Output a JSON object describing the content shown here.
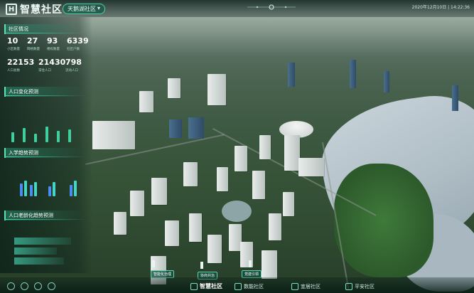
{
  "app": {
    "title": "智慧社区",
    "logo_mark": "H"
  },
  "header": {
    "community_selector": "天鹅湖社区",
    "datetime": "2020年12月10日 | 14:22:36"
  },
  "left_panel": {
    "community_status": {
      "title": "社区情况",
      "stats": [
        {
          "value": "10",
          "label": "小区数量"
        },
        {
          "value": "27",
          "label": "网格数量"
        },
        {
          "value": "93",
          "label": "楼栋数量"
        },
        {
          "value": "6339",
          "label": "社区户数"
        },
        {
          "value": "22153",
          "label": "人口总数"
        },
        {
          "value": "21430",
          "label": "常住人口"
        },
        {
          "value": "798",
          "label": "流动人口"
        }
      ]
    },
    "population_change": {
      "title": "人口变化预测"
    },
    "school_trend": {
      "title": "入学趋势预测"
    },
    "aging_trend": {
      "title": "人口老龄化趋势预测"
    }
  },
  "map_labels": [
    "智能化治理",
    "协商共治",
    "党建引领"
  ],
  "bottom_nav": {
    "items": [
      {
        "label": "智慧社区",
        "icon": "building-icon",
        "active": true
      },
      {
        "label": "数能社区",
        "icon": "data-icon",
        "active": false
      },
      {
        "label": "宜居社区",
        "icon": "home-icon",
        "active": false
      },
      {
        "label": "平安社区",
        "icon": "shield-icon",
        "active": false
      }
    ]
  },
  "colors": {
    "accent": "#4fd1a8",
    "panel_bg": "#081c16",
    "text": "#d8f4ea"
  }
}
